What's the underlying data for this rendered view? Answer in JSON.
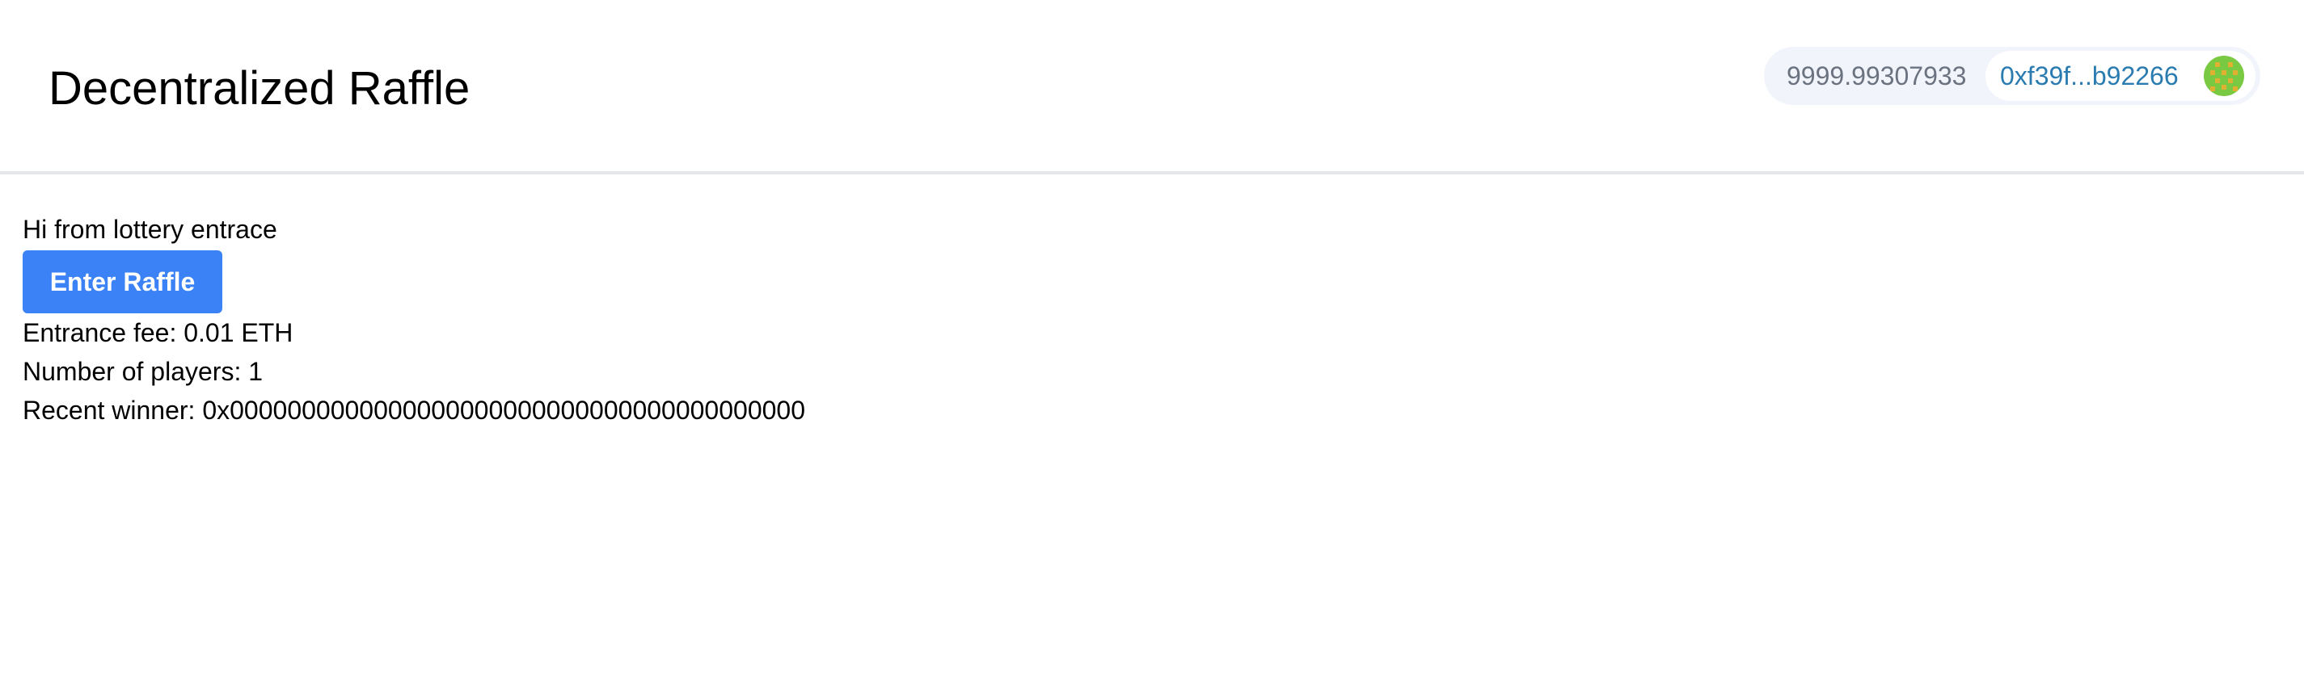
{
  "header": {
    "title": "Decentralized Raffle"
  },
  "wallet": {
    "balance": "9999.99307933",
    "address": "0xf39f...b92266",
    "avatar_icon": "identicon-avatar",
    "avatar_colors": {
      "background": "#7ac943",
      "pattern": "#e0b030"
    }
  },
  "main": {
    "greeting": "Hi from lottery entrace",
    "enter_button_label": "Enter Raffle",
    "entrance_fee": "Entrance fee: 0.01 ETH",
    "players": "Number of players: 1",
    "recent_winner": "Recent winner: 0x0000000000000000000000000000000000000000"
  },
  "colors": {
    "button": "#3b82f6",
    "address_text": "#2a7bb0",
    "balance_text": "#6b7280",
    "wallet_background": "#f1f5fb"
  }
}
